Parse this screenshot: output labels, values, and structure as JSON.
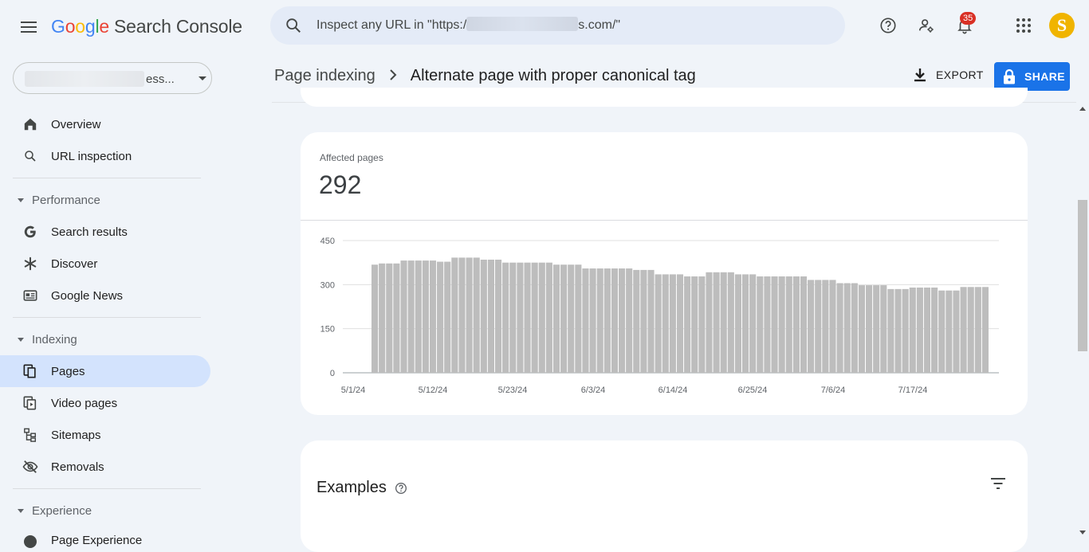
{
  "app": {
    "logo_google": [
      "G",
      "o",
      "o",
      "g",
      "l",
      "e"
    ],
    "logo_colors": [
      "#4285f4",
      "#ea4335",
      "#fbbc05",
      "#4285f4",
      "#34a853",
      "#ea4335"
    ],
    "logo_product": "Search Console"
  },
  "search": {
    "placeholder_prefix": "Inspect any URL in \"https:/",
    "placeholder_suffix": "s.com/\""
  },
  "topbar": {
    "notification_count": "35",
    "avatar_letter": "S",
    "avatar_color": "#f0b400"
  },
  "property": {
    "visible_text": "ess..."
  },
  "nav": {
    "overview": "Overview",
    "url_inspection": "URL inspection",
    "performance": "Performance",
    "search_results": "Search results",
    "discover": "Discover",
    "google_news": "Google News",
    "indexing": "Indexing",
    "pages": "Pages",
    "video_pages": "Video pages",
    "sitemaps": "Sitemaps",
    "removals": "Removals",
    "experience": "Experience",
    "page_experience": "Page Experience"
  },
  "header": {
    "breadcrumb_parent": "Page indexing",
    "breadcrumb_current": "Alternate page with proper canonical tag",
    "export_label": "EXPORT",
    "share_label": "SHARE"
  },
  "summary": {
    "label": "Affected pages",
    "value": "292"
  },
  "chart_data": {
    "type": "bar",
    "xlabel": "",
    "ylabel": "",
    "ylim": [
      0,
      450
    ],
    "yticks": [
      "0",
      "150",
      "300",
      "450"
    ],
    "xticks": [
      "5/1/24",
      "5/12/24",
      "5/23/24",
      "6/3/24",
      "6/14/24",
      "6/25/24",
      "7/6/24",
      "7/17/24"
    ],
    "categories": [
      "5/1/24",
      "5/2/24",
      "5/3/24",
      "5/4/24",
      "5/5/24",
      "5/6/24",
      "5/7/24",
      "5/8/24",
      "5/9/24",
      "5/10/24",
      "5/11/24",
      "5/12/24",
      "5/13/24",
      "5/14/24",
      "5/15/24",
      "5/16/24",
      "5/17/24",
      "5/18/24",
      "5/19/24",
      "5/20/24",
      "5/21/24",
      "5/22/24",
      "5/23/24",
      "5/24/24",
      "5/25/24",
      "5/26/24",
      "5/27/24",
      "5/28/24",
      "5/29/24",
      "5/30/24",
      "5/31/24",
      "6/1/24",
      "6/2/24",
      "6/3/24",
      "6/4/24",
      "6/5/24",
      "6/6/24",
      "6/7/24",
      "6/8/24",
      "6/9/24",
      "6/10/24",
      "6/11/24",
      "6/12/24",
      "6/13/24",
      "6/14/24",
      "6/15/24",
      "6/16/24",
      "6/17/24",
      "6/18/24",
      "6/19/24",
      "6/20/24",
      "6/21/24",
      "6/22/24",
      "6/23/24",
      "6/24/24",
      "6/25/24",
      "6/26/24",
      "6/27/24",
      "6/28/24",
      "6/29/24",
      "6/30/24",
      "7/1/24",
      "7/2/24",
      "7/3/24",
      "7/4/24",
      "7/5/24",
      "7/6/24",
      "7/7/24",
      "7/8/24",
      "7/9/24",
      "7/10/24",
      "7/11/24",
      "7/12/24",
      "7/13/24",
      "7/14/24",
      "7/15/24",
      "7/16/24",
      "7/17/24",
      "7/18/24",
      "7/19/24",
      "7/20/24",
      "7/21/24",
      "7/22/24",
      "7/23/24",
      "7/24/24",
      "7/25/24",
      "7/26/24",
      "7/27/24",
      "7/28/24",
      "7/29/24",
      "7/30/24"
    ],
    "values": [
      0,
      0,
      0,
      0,
      0,
      0,
      0,
      0,
      0,
      0,
      0,
      0,
      0,
      0,
      0,
      0,
      0,
      0,
      0,
      0,
      0,
      0,
      0,
      0,
      0,
      0,
      0,
      0,
      0,
      0,
      0,
      0,
      0,
      0,
      0,
      0,
      0,
      0,
      0,
      0,
      0,
      0,
      0,
      0,
      0,
      0,
      0,
      0,
      0,
      0,
      0,
      0,
      0,
      0,
      0,
      0,
      0,
      0,
      0,
      0,
      0,
      0,
      0,
      0,
      0,
      0,
      0,
      0,
      0,
      0,
      0,
      0,
      0,
      0,
      0,
      0,
      0,
      0,
      0,
      0,
      0,
      0,
      0,
      0,
      0,
      0,
      0,
      0,
      0,
      0,
      0
    ],
    "series": [
      {
        "values": [
          368,
          372,
          372,
          372,
          382,
          382,
          382,
          382,
          382,
          378,
          378,
          392,
          392,
          392,
          392,
          385,
          385,
          385,
          375,
          375,
          375,
          375,
          375,
          375,
          375,
          368,
          368,
          368,
          368,
          355,
          355,
          355,
          355,
          355,
          355,
          355,
          350,
          350,
          350,
          335,
          335,
          335,
          335,
          328,
          328,
          328,
          342,
          342,
          342,
          342,
          335,
          335,
          335,
          328,
          328,
          328,
          328,
          328,
          328,
          328,
          316,
          316,
          316,
          316,
          305,
          305,
          305,
          298,
          298,
          298,
          298,
          285,
          285,
          285,
          290,
          290,
          290,
          290,
          280,
          280,
          280,
          292,
          292,
          292,
          292
        ]
      }
    ]
  },
  "examples": {
    "title": "Examples"
  }
}
